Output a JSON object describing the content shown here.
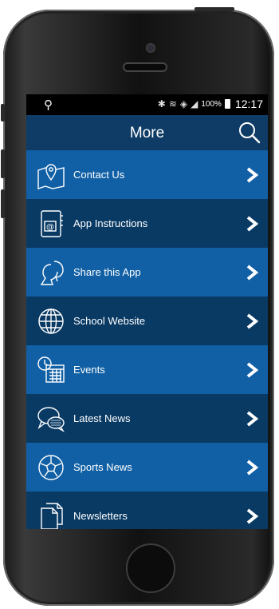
{
  "status_bar": {
    "location_icon": "location-pin-icon",
    "indicators": [
      "bluetooth-icon",
      "vibrate-icon",
      "wifi-icon",
      "signal-icon"
    ],
    "battery": "100%",
    "time": "12:17"
  },
  "header": {
    "title": "More",
    "search_icon": "search-icon"
  },
  "menu": {
    "items": [
      {
        "label": "Contact Us",
        "icon": "map-pin-icon"
      },
      {
        "label": "App Instructions",
        "icon": "address-book-icon"
      },
      {
        "label": "Share this App",
        "icon": "share-person-icon"
      },
      {
        "label": "School Website",
        "icon": "globe-icon"
      },
      {
        "label": "Events",
        "icon": "calendar-clock-icon"
      },
      {
        "label": "Latest News",
        "icon": "chat-bubbles-icon"
      },
      {
        "label": "Sports News",
        "icon": "soccer-ball-icon"
      },
      {
        "label": "Newsletters",
        "icon": "documents-icon"
      }
    ]
  },
  "colors": {
    "header": "#0e3c66",
    "row_light": "#1160a5",
    "row_dark": "#093a64",
    "text": "#ffffff"
  }
}
